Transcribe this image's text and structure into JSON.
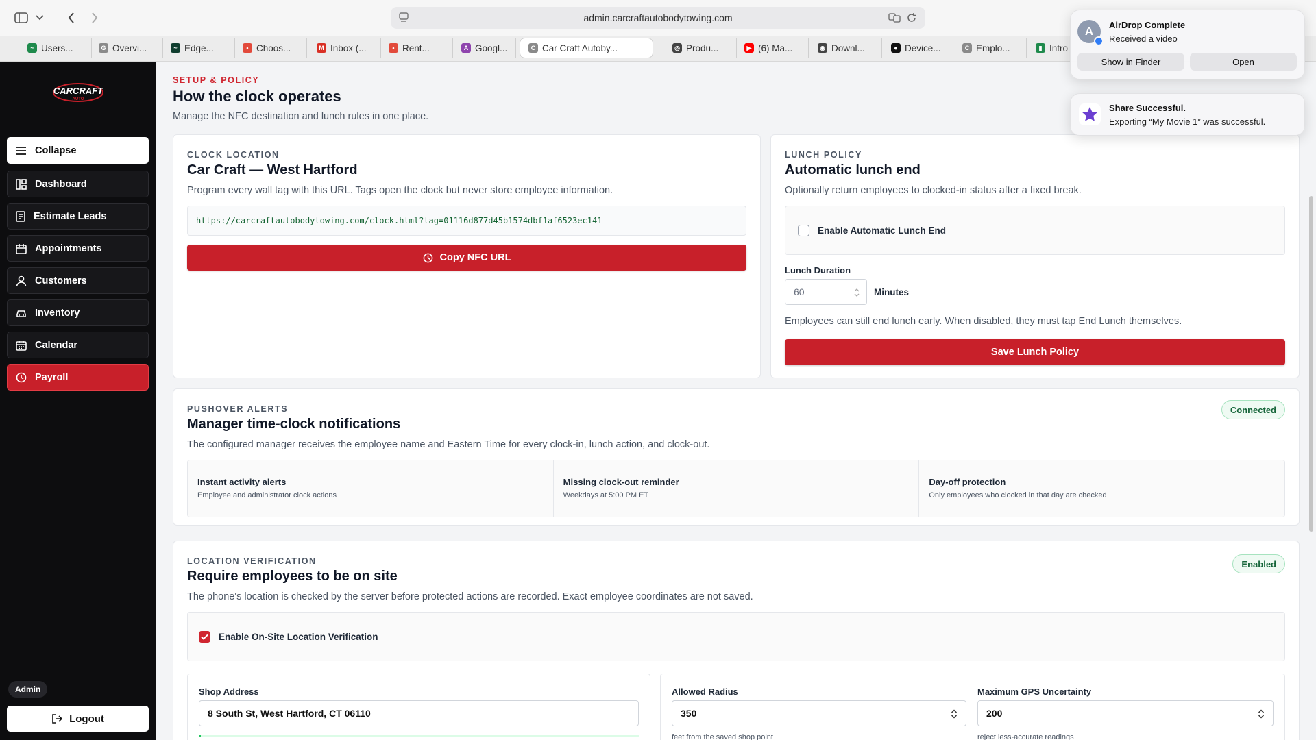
{
  "browser": {
    "url": "admin.carcraftautobodytowing.com",
    "tabs": [
      {
        "label": "Users...",
        "color": "#1f8a4c",
        "glyph": "~"
      },
      {
        "label": "Overvi...",
        "color": "#8a8a8a",
        "glyph": "G"
      },
      {
        "label": "Edge...",
        "color": "#0f3d2e",
        "glyph": "~"
      },
      {
        "label": "Choos...",
        "color": "#e24a3b",
        "glyph": "•"
      },
      {
        "label": "Inbox (...",
        "color": "#d93025",
        "glyph": "M"
      },
      {
        "label": "Rent...",
        "color": "#e24a3b",
        "glyph": "•"
      },
      {
        "label": "Googl...",
        "color": "#8e44ad",
        "glyph": "A"
      },
      {
        "label": "Car Craft Autoby...",
        "color": "#8a8a8a",
        "glyph": "C"
      },
      {
        "label": "Produ...",
        "color": "#444444",
        "glyph": "◎"
      },
      {
        "label": "(6) Ma...",
        "color": "#ff0000",
        "glyph": "▶"
      },
      {
        "label": "Downl...",
        "color": "#444444",
        "glyph": "◉"
      },
      {
        "label": "Device...",
        "color": "#111111",
        "glyph": "●"
      },
      {
        "label": "Emplo...",
        "color": "#8a8a8a",
        "glyph": "C"
      },
      {
        "label": "Intro",
        "color": "#1f8a4c",
        "glyph": "▮"
      }
    ]
  },
  "sidebar": {
    "logo_text": "CARCRAFT",
    "logo_sub": "AUTO",
    "items": [
      {
        "label": "Collapse",
        "icon": "menu-icon"
      },
      {
        "label": "Dashboard",
        "icon": "dashboard-icon"
      },
      {
        "label": "Estimate Leads",
        "icon": "document-icon"
      },
      {
        "label": "Appointments",
        "icon": "calendar-check-icon"
      },
      {
        "label": "Customers",
        "icon": "user-icon"
      },
      {
        "label": "Inventory",
        "icon": "car-icon"
      },
      {
        "label": "Calendar",
        "icon": "calendar-icon"
      },
      {
        "label": "Payroll",
        "icon": "clock-icon"
      }
    ],
    "role": "Admin",
    "logout": "Logout"
  },
  "setup": {
    "eyebrow": "SETUP & POLICY",
    "title": "How the clock operates",
    "desc": "Manage the NFC destination and lunch rules in one place."
  },
  "clock": {
    "eyebrow": "CLOCK LOCATION",
    "title": "Car Craft — West Hartford",
    "desc": "Program every wall tag with this URL. Tags open the clock but never store employee information.",
    "url": "https://carcraftautobodytowing.com/clock.html?tag=01116d877d45b1574dbf1af6523ec141",
    "button": "Copy NFC URL"
  },
  "lunch": {
    "eyebrow": "LUNCH POLICY",
    "title": "Automatic lunch end",
    "desc": "Optionally return employees to clocked-in status after a fixed break.",
    "toggle_label": "Enable Automatic Lunch End",
    "enabled": false,
    "duration_label": "Lunch Duration",
    "duration_value": "60",
    "duration_unit": "Minutes",
    "note": "Employees can still end lunch early. When disabled, they must tap End Lunch themselves.",
    "button": "Save Lunch Policy"
  },
  "pushover": {
    "eyebrow": "PUSHOVER ALERTS",
    "title": "Manager time-clock notifications",
    "desc": "The configured manager receives the employee name and Eastern Time for every clock-in, lunch action, and clock-out.",
    "status": "Connected",
    "features": [
      {
        "title": "Instant activity alerts",
        "desc": "Employee and administrator clock actions"
      },
      {
        "title": "Missing clock-out reminder",
        "desc": "Weekdays at 5:00 PM ET"
      },
      {
        "title": "Day-off protection",
        "desc": "Only employees who clocked in that day are checked"
      }
    ]
  },
  "location": {
    "eyebrow": "LOCATION VERIFICATION",
    "title": "Require employees to be on site",
    "desc": "The phone's location is checked by the server before protected actions are recorded. Exact employee coordinates are not saved.",
    "status": "Enabled",
    "toggle_label": "Enable On-Site Location Verification",
    "enabled": true,
    "address_label": "Shop Address",
    "address_value": "8 South St, West Hartford, CT 06110",
    "radius_label": "Allowed Radius",
    "radius_value": "350",
    "radius_hint": "feet from the saved shop point",
    "gps_label": "Maximum GPS Uncertainty",
    "gps_value": "200",
    "gps_hint": "reject less-accurate readings"
  },
  "notifications": [
    {
      "title": "AirDrop Complete",
      "body": "Received a video",
      "avatar": "A",
      "actions": [
        "Show in Finder",
        "Open"
      ]
    },
    {
      "title": "Share Successful.",
      "body": "Exporting “My Movie 1” was successful."
    }
  ],
  "colors": {
    "accent": "#c8202a",
    "sidebar": "#0d0d0f",
    "success": "#16653a"
  }
}
